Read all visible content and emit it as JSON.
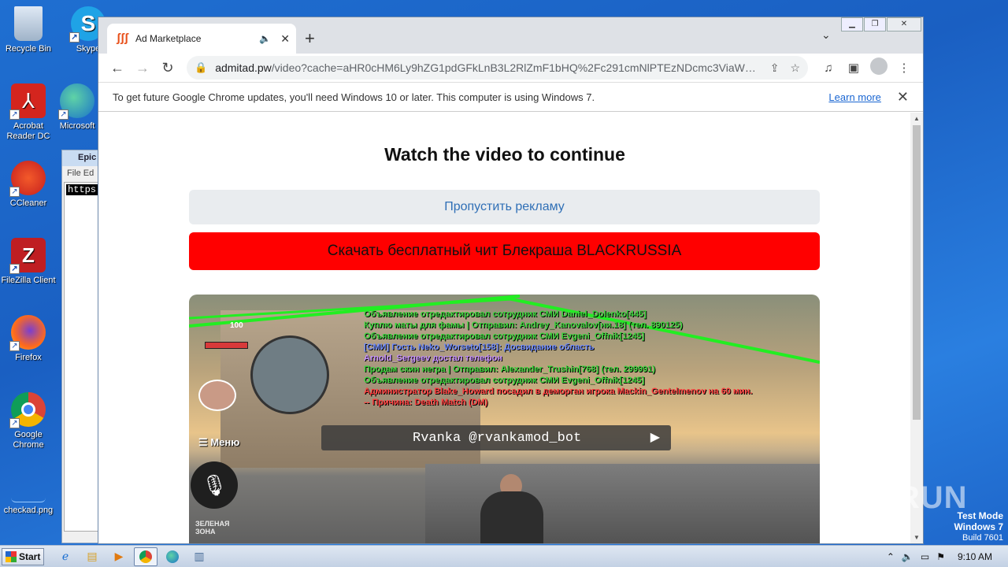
{
  "desktop": {
    "icons": [
      {
        "label": "Recycle Bin"
      },
      {
        "label": "Skype"
      },
      {
        "label": "Acrobat Reader DC"
      },
      {
        "label": "Microsoft"
      },
      {
        "label": "CCleaner"
      },
      {
        "label": "FileZilla Client"
      },
      {
        "label": "Firefox"
      },
      {
        "label": "Google Chrome"
      },
      {
        "label": "checkad.png"
      }
    ],
    "notepad": {
      "title": "Epic",
      "menu": "File  Ed",
      "selected_text": "https"
    }
  },
  "browser": {
    "tab": {
      "title": "Ad Marketplace"
    },
    "address": {
      "host": "admitad.pw",
      "path": "/video?cache=aHR0cHM6Ly9hZG1pdGFkLnB3L2RlZmF1bHQ%2Fc291cmNlPTEzNDcmc3ViaWQ9TF..."
    },
    "infobar": {
      "message": "To get future Google Chrome updates, you'll need Windows 10 or later. This computer is using Windows 7.",
      "link": "Learn more"
    }
  },
  "page": {
    "heading": "Watch the video to continue",
    "skip_button": "Пропустить рекламу",
    "download_button": "Скачать бесплатный чит Блекраша BLACKRUSSIA",
    "video": {
      "chat_lines": [
        {
          "text": "Объявление отредактировал сотрудник СМИ Daniel_Dolenko[445]",
          "color": "#3cd43c"
        },
        {
          "text": "Куплю маты для фамы | Отправил: Andrey_Kanovalov[ни.18] (тел. 890125)",
          "color": "#3cd43c"
        },
        {
          "text": "Объявление отредактировал сотрудник СМИ Evgeni_Offnik[1245]",
          "color": "#3cd43c"
        },
        {
          "text": "[СМИ] Гость Neko_Worseto[158]: Досвидание область",
          "color": "#6f8cff"
        },
        {
          "text": "Arnold_Sergeev достал телефон",
          "color": "#c690ff"
        },
        {
          "text": "Продам скин негра | Отправил: Alexander_Trushin[768] (тел. 299991)",
          "color": "#3cd43c"
        },
        {
          "text": "Объявление отредактировал сотрудник СМИ Evgeni_Offnik[1245]",
          "color": "#3cd43c"
        },
        {
          "text": "Администратор Blake_Howard посадил в деморган игрока Mackin_Gentelmenov на 60 мин.",
          "color": "#ff4040"
        },
        {
          "text": "-- Причина: Death Match (DM)",
          "color": "#ff4040"
        }
      ],
      "menu_label": "Меню",
      "overlay_text": "Rvanka @rvankamod_bot",
      "zone_label": "ЗЕЛЕНАЯ ЗОНА",
      "hud_number": "100"
    }
  },
  "system": {
    "watermark": "ANY RUN",
    "test_mode": "Test Mode",
    "os": "Windows 7",
    "build": "Build 7601",
    "start_label": "Start",
    "clock": "9:10 AM"
  }
}
